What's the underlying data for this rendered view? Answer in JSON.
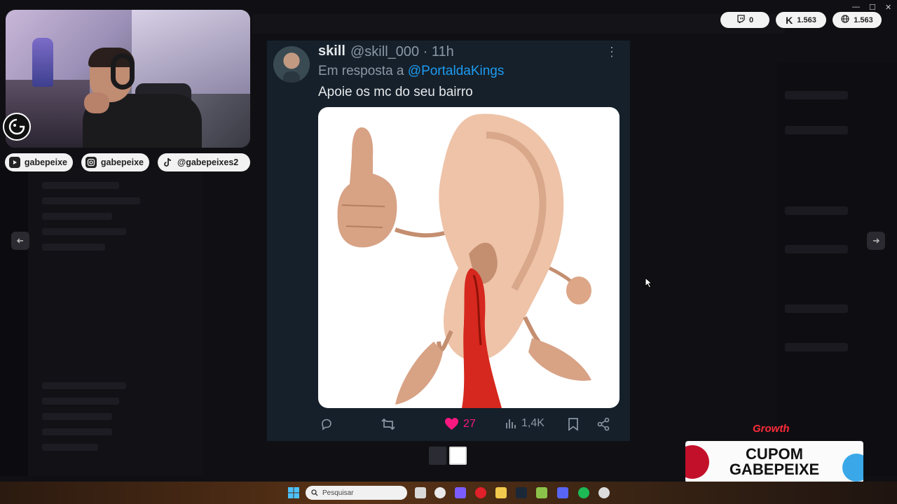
{
  "social": {
    "youtube": "gabepeixe",
    "instagram": "gabepeixe",
    "tiktok": "@gabepeixes2"
  },
  "stats": {
    "twitch": "0",
    "kick": "1.563",
    "total": "1.563"
  },
  "tweet": {
    "name": "skill",
    "meta": "@skill_000 · 11h",
    "reply_prefix": "Em resposta a ",
    "reply_to": "@PortaldaKings",
    "text": "Apoie os mc do seu bairro",
    "likes": "27",
    "views": "1,4K",
    "liked": true
  },
  "promo": {
    "brand": "Growth",
    "line1": "CUPOM",
    "line2": "GABEPEIXE"
  },
  "taskbar": {
    "search_placeholder": "Pesquisar"
  },
  "colors": {
    "tweet_bg": "#15202b",
    "link": "#1d9bf0",
    "like": "#f91880",
    "muted": "#8b98a5"
  }
}
